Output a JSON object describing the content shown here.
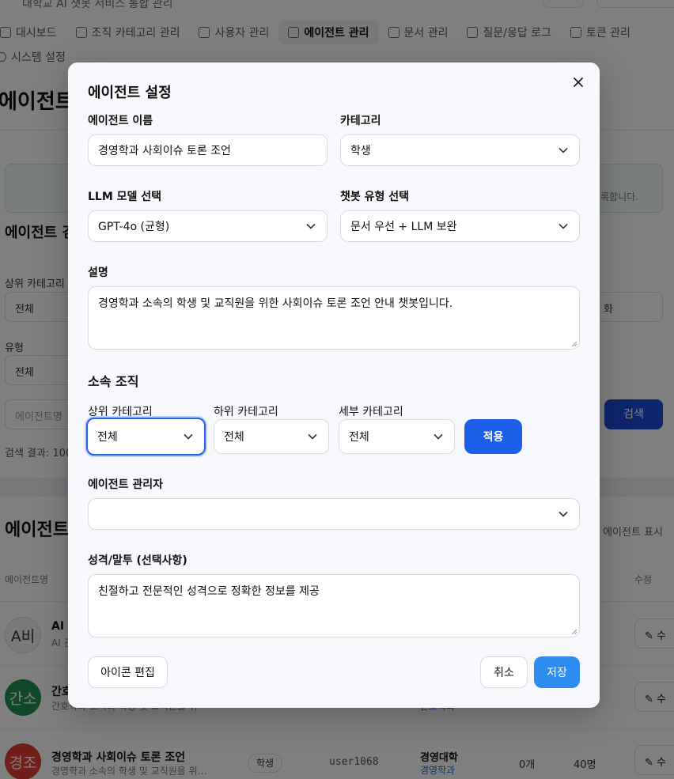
{
  "background": {
    "header_subtitle": "대학교 AI 챗봇 서비스 통합 관리",
    "nav": [
      {
        "label": "대시보드",
        "icon": "bar-chart-icon"
      },
      {
        "label": "조직 카테고리 관리",
        "icon": "database-icon"
      },
      {
        "label": "사용자 관리",
        "icon": "users-icon"
      },
      {
        "label": "에이전트 관리",
        "icon": "bot-icon"
      },
      {
        "label": "문서 관리",
        "icon": "document-icon"
      },
      {
        "label": "질문/응답 로그",
        "icon": "message-icon"
      },
      {
        "label": "토큰 관리",
        "icon": "token-icon"
      }
    ],
    "nav2_label": "시스템 설정",
    "page_title": "에이전트 관",
    "notice_text": "록합니다.",
    "filter_section_title": "에이전트 검",
    "filter_upper_label": "상위 카테고리",
    "filter_upper_value": "전체",
    "filter_type_label": "유형",
    "filter_type_value": "전체",
    "filter_right_value": "화",
    "search_placeholder": "에이전트명",
    "search_button": "검색",
    "result_text": "검색 결과: 100",
    "list_title": "에이전트",
    "list_toggle_text": "에이전트 표시",
    "col_name": "에이전트명",
    "col_edit": "수정",
    "rows": [
      {
        "avatar": "A비",
        "name": "AI ·",
        "desc": "AI 관"
      },
      {
        "avatar": "간소",
        "name": "간호",
        "desc": "간호학과 소속의 학생 및 교직원을 위",
        "org": "간호학과"
      },
      {
        "avatar": "경조",
        "name": "경영학과 사회이슈 토론 조언",
        "desc": "경영학과 소속의 학생 및 교직원을 위…",
        "tag": "학생",
        "user": "user1068",
        "org_parent": "경영대학",
        "org_child": "경영학과",
        "docs": "0개",
        "users": "40명"
      }
    ],
    "edit_label": "수"
  },
  "modal": {
    "title": "에이전트 설정",
    "name_label": "에이전트 이름",
    "name_value": "경영학과 사회이슈 토론 조언",
    "category_label": "카테고리",
    "category_value": "학생",
    "llm_label": "LLM 모델 선택",
    "llm_value": "GPT-4o (균형)",
    "bot_type_label": "챗봇 유형 선택",
    "bot_type_value": "문서 우선 + LLM 보완",
    "desc_label": "설명",
    "desc_value": "경영학과 소속의 학생 및 교직원을 위한 사회이슈 토론 조언 안내 챗봇입니다.",
    "org_section": "소속 조직",
    "upper_label": "상위 카테고리",
    "upper_value": "전체",
    "lower_label": "하위 카테고리",
    "lower_value": "전체",
    "detail_label": "세부 카테고리",
    "detail_value": "전체",
    "apply_button": "적용",
    "manager_label": "에이전트 관리자",
    "manager_value": "",
    "persona_label": "성격/말투 (선택사항)",
    "persona_value": "친절하고 전문적인 성격으로 정확한 정보를 제공",
    "icon_edit_button": "아이콘 편집",
    "cancel_button": "취소",
    "save_button": "저장"
  },
  "colors": {
    "primary": "#1d5fe8",
    "save": "#2d8cf0",
    "focus_ring": "#2563eb",
    "overlay": "rgba(0,0,0,0.5)"
  }
}
